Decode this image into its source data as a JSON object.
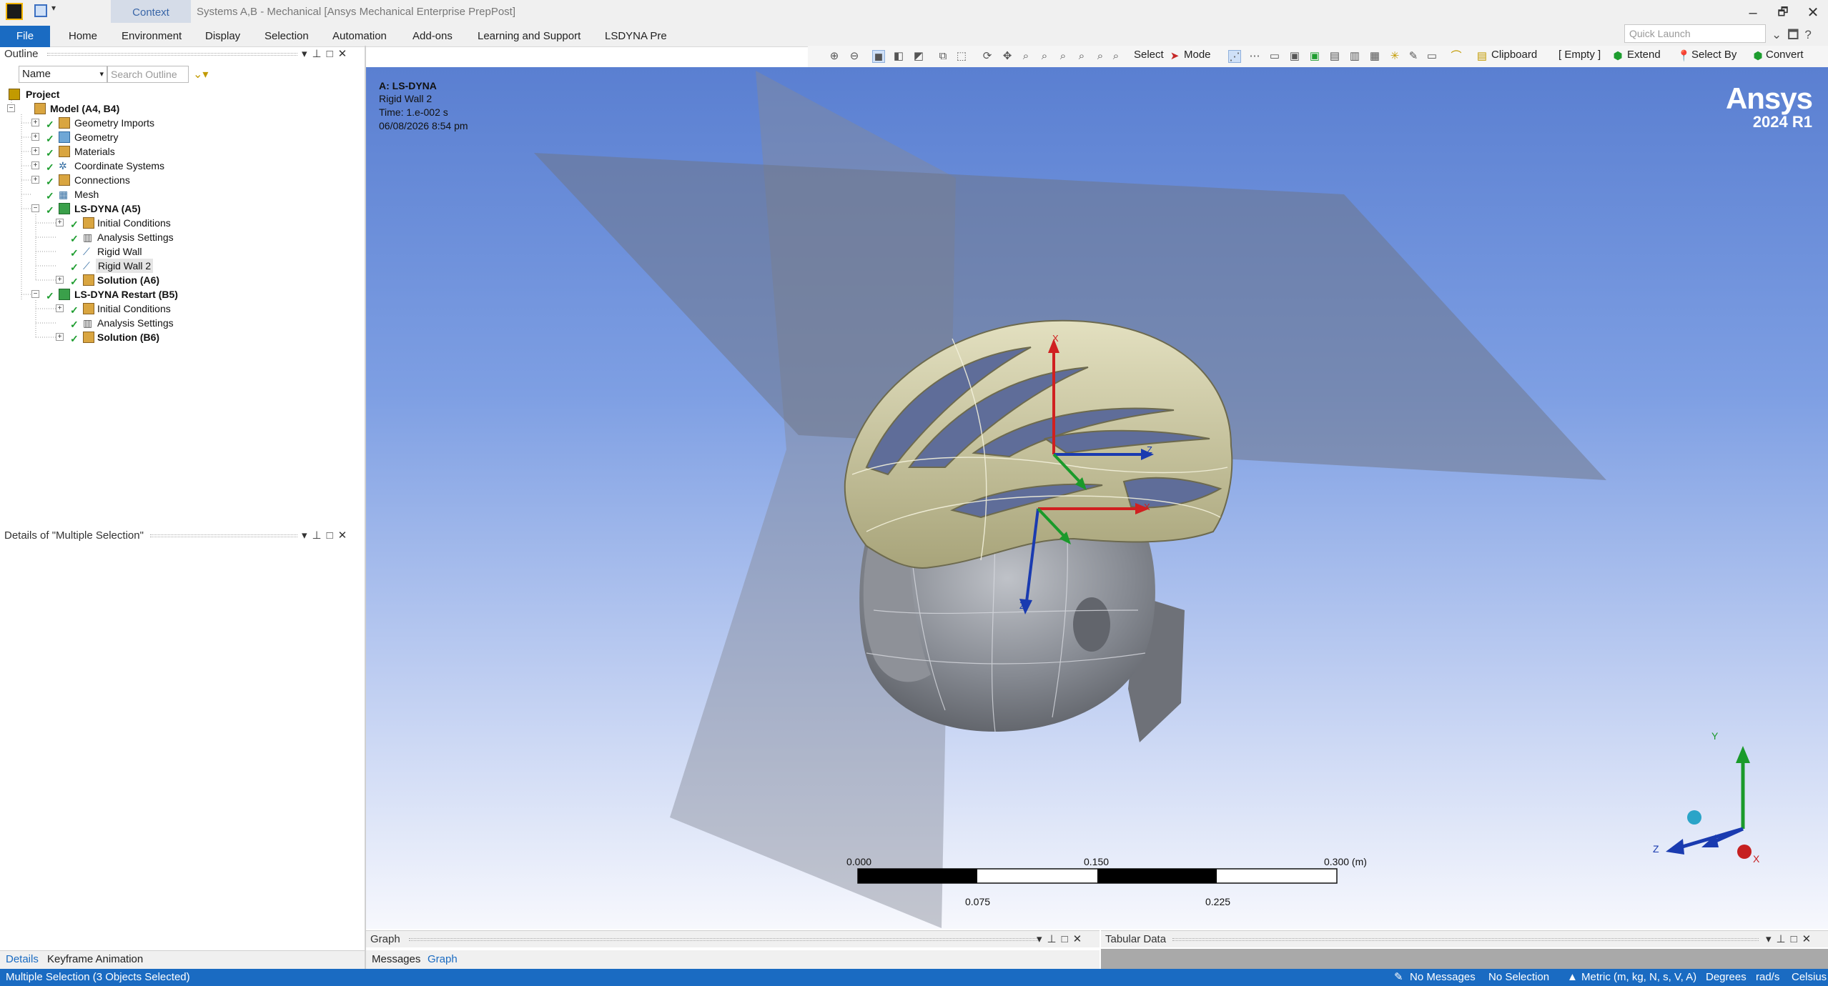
{
  "window": {
    "context_tab": "Context",
    "title": "Systems A,B - Mechanical [Ansys Mechanical Enterprise PrepPost]",
    "controls": [
      "–",
      "🗗",
      "✕"
    ]
  },
  "menu": {
    "file": "File",
    "items": [
      "Home",
      "Environment",
      "Display",
      "Selection",
      "Automation",
      "Add-ons",
      "Learning and Support",
      "LSDYNA Pre"
    ],
    "quick_launch_placeholder": "Quick Launch"
  },
  "toolbar": {
    "select_label": "Select",
    "mode_label": "Mode",
    "clipboard_label": "Clipboard",
    "empty_label": "[ Empty ]",
    "extend_label": "Extend",
    "select_by_label": "Select By",
    "convert_label": "Convert"
  },
  "outline": {
    "title": "Outline",
    "name_select": "Name",
    "search_placeholder": "Search Outline",
    "tree": {
      "project": "Project",
      "model": "Model (A4, B4)",
      "geometry_imports": "Geometry Imports",
      "geometry": "Geometry",
      "materials": "Materials",
      "coordinate_systems": "Coordinate Systems",
      "connections": "Connections",
      "mesh": "Mesh",
      "lsdyna": "LS-DYNA (A5)",
      "lsdyna_initial": "Initial Conditions",
      "lsdyna_analysis": "Analysis Settings",
      "rigid_wall": "Rigid Wall",
      "rigid_wall_2": "Rigid Wall 2",
      "solution_a6": "Solution (A6)",
      "restart": "LS-DYNA Restart (B5)",
      "restart_initial": "Initial Conditions",
      "restart_analysis": "Analysis Settings",
      "solution_b6": "Solution (B6)"
    }
  },
  "details": {
    "title": "Details of \"Multiple Selection\""
  },
  "left_tabs": {
    "details": "Details",
    "keyframe": "Keyframe Animation"
  },
  "viewport": {
    "analysis": "A: LS-DYNA",
    "object": "Rigid Wall 2",
    "time": "Time: 1.e-002 s",
    "date": "06/08/2026 8:54 pm",
    "brand": "Ansys",
    "version": "2024 R1",
    "axis_x": "X",
    "axis_y": "Y",
    "axis_z": "Z",
    "scale": {
      "top_labels": [
        "0.000",
        "0.150",
        "0.300 (m)"
      ],
      "bottom_labels": [
        "0.075",
        "0.225"
      ]
    }
  },
  "graph": {
    "title": "Graph",
    "tab_messages": "Messages",
    "tab_graph": "Graph"
  },
  "tabular": {
    "title": "Tabular Data"
  },
  "status": {
    "selection": "Multiple Selection (3 Objects Selected)",
    "messages": "No Messages",
    "no_selection": "No Selection",
    "units": "Metric (m, kg, N, s, V, A)",
    "angle": "Degrees",
    "rate": "rad/s",
    "temp": "Celsius"
  },
  "colors": {
    "accent": "#1a6bc2",
    "helmet": "#c9c59a",
    "head": "#7a7d84"
  }
}
